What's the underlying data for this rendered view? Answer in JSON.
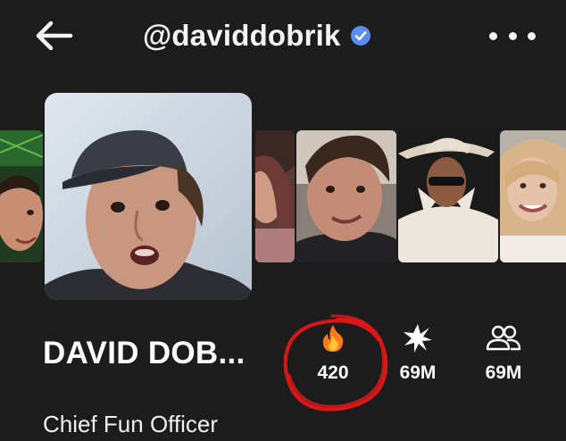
{
  "header": {
    "username": "@daviddobrik",
    "back_icon": "arrow-left-icon",
    "verified_icon": "verified-badge-icon",
    "more_icon": "more-horizontal-icon"
  },
  "profile": {
    "display_name": "DAVID DOB...",
    "bio": "Chief Fun Officer"
  },
  "stats": [
    {
      "icon": "fire-icon",
      "value": "420"
    },
    {
      "icon": "sparkle-icon",
      "value": "69M"
    },
    {
      "icon": "friends-icon",
      "value": "69M"
    }
  ],
  "colors": {
    "background": "#1c1c1c",
    "verified_blue": "#5b8def",
    "annotation_red": "#d81818",
    "text": "#ffffff"
  }
}
